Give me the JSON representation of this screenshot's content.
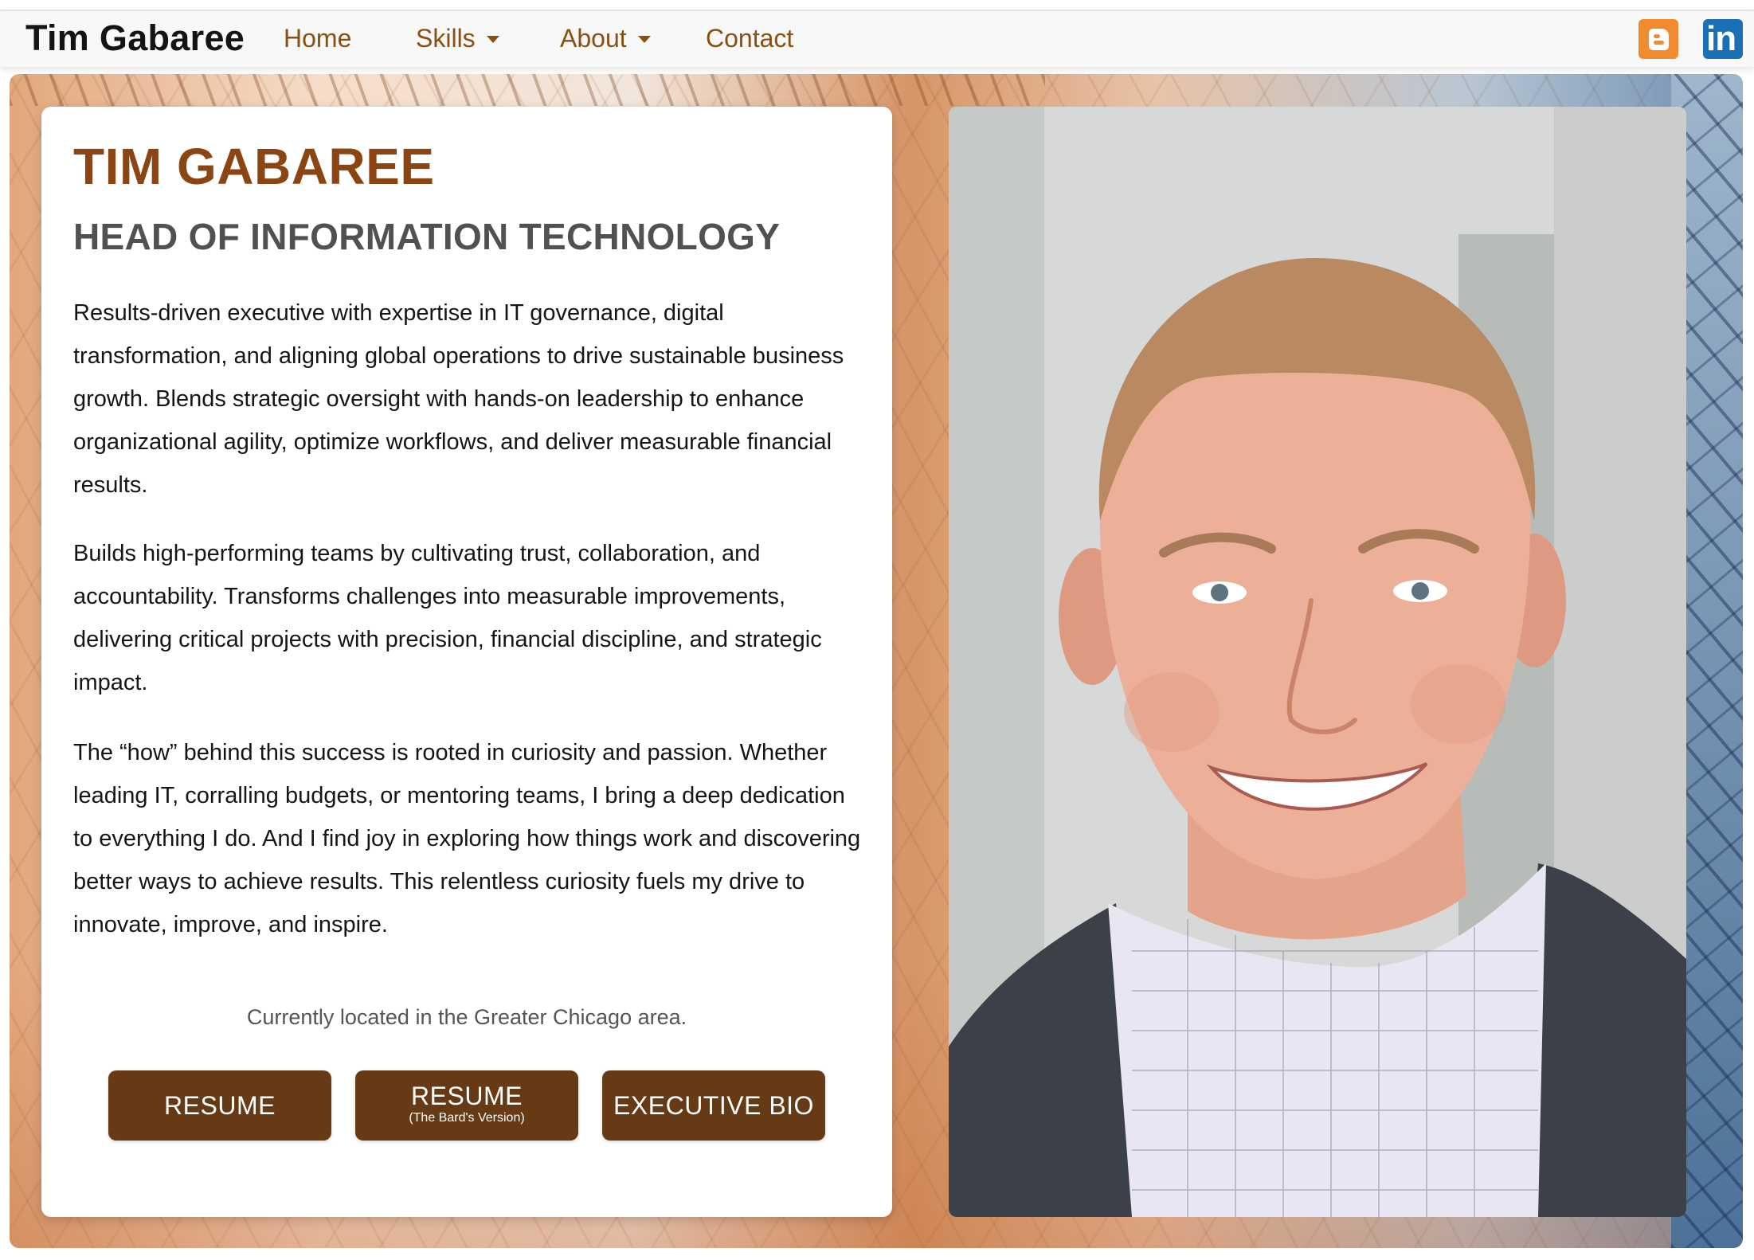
{
  "nav": {
    "brand": "Tim Gabaree",
    "home": "Home",
    "skills": "Skills",
    "about": "About",
    "contact": "Contact",
    "social": [
      {
        "name": "blogger-icon",
        "color": "#f28b30"
      },
      {
        "name": "linkedin-icon",
        "color": "#1b6fb5",
        "glyph": "in"
      }
    ],
    "link_color": "#8a4f12"
  },
  "card": {
    "name": "TIM GABAREE",
    "title": "HEAD OF INFORMATION TECHNOLOGY",
    "bio": [
      "Results-driven executive with expertise in IT governance, digital transformation, and aligning global operations to drive sustainable business growth. Blends strategic oversight with hands-on leadership to enhance organizational agility, optimize workflows, and deliver measurable financial results.",
      "Builds high-performing teams by cultivating trust, collaboration, and accountability. Transforms challenges into measurable improvements, delivering critical projects with precision, financial discipline, and strategic impact.",
      "The “how” behind this success is rooted in curiosity and passion. Whether leading IT, corralling budgets, or mentoring teams, I bring a deep dedication to everything I do. And I find joy in exploring how things work and discovering better ways to achieve results. This relentless curiosity fuels my drive to innovate, improve, and inspire."
    ],
    "location": "Currently located in the Greater Chicago area.",
    "buttons": {
      "resume": "RESUME",
      "bard": "RESUME",
      "bard_sub": "(The Bard's Version)",
      "exec_bio": "EXECUTIVE BIO"
    },
    "name_color": "#8a4513",
    "button_color": "#653a14"
  }
}
